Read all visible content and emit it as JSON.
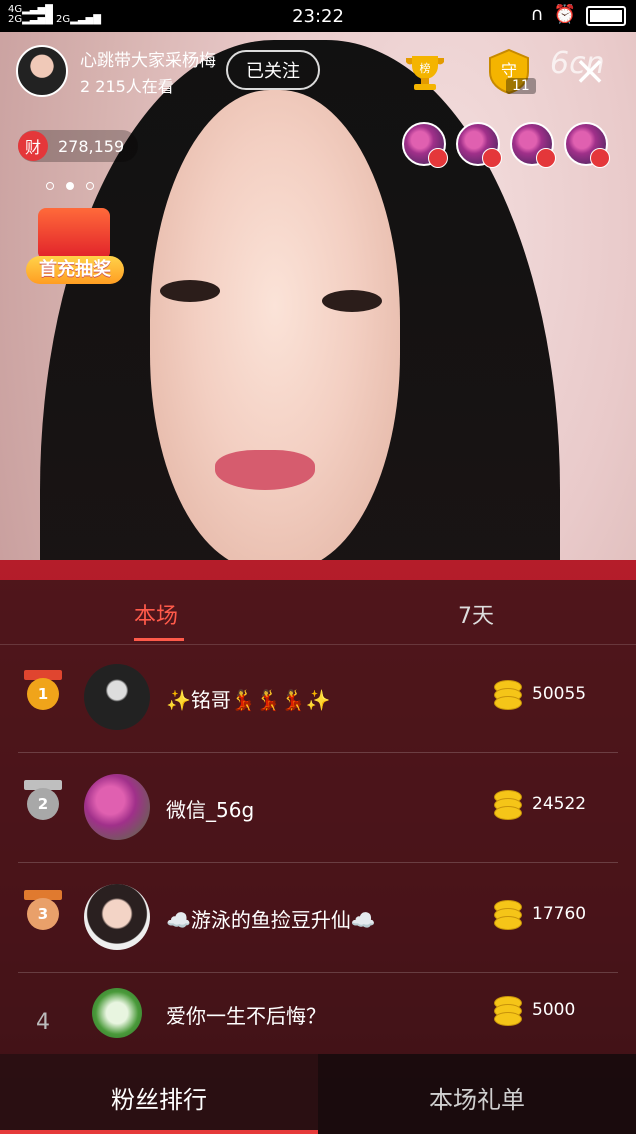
{
  "status_bar": {
    "network_left": "4G\n2G",
    "network_mid": "2G",
    "time": "23:22"
  },
  "host": {
    "name": "心跳带大家采杨梅",
    "viewers": "2 215人在看",
    "follow_label": "已关注"
  },
  "icons": {
    "rank_label": "榜",
    "guard_label": "守",
    "guard_count": "11",
    "watermark": "6cn",
    "close": "×"
  },
  "wealth": {
    "badge": "财",
    "value": "278,159"
  },
  "promo": {
    "label": "首充抽奖"
  },
  "ranking": {
    "tabs": [
      {
        "label": "本场"
      },
      {
        "label": "7天"
      }
    ],
    "rows": [
      {
        "rank": "1",
        "name": "✨铭哥💃💃💃✨",
        "score": "50055"
      },
      {
        "rank": "2",
        "name": "微信_56g",
        "score": "24522"
      },
      {
        "rank": "3",
        "name": "☁️游泳的鱼捡豆升仙☁️",
        "score": "17760"
      },
      {
        "rank": "4",
        "name": "爱你一生不后悔？",
        "score": "5000"
      }
    ]
  },
  "bottom_tabs": {
    "fans": "粉丝排行",
    "gifts": "本场礼单"
  },
  "colors": {
    "accent": "#ff5a4a",
    "gold": "#f5c518",
    "panel_bg": "#2a1416"
  }
}
